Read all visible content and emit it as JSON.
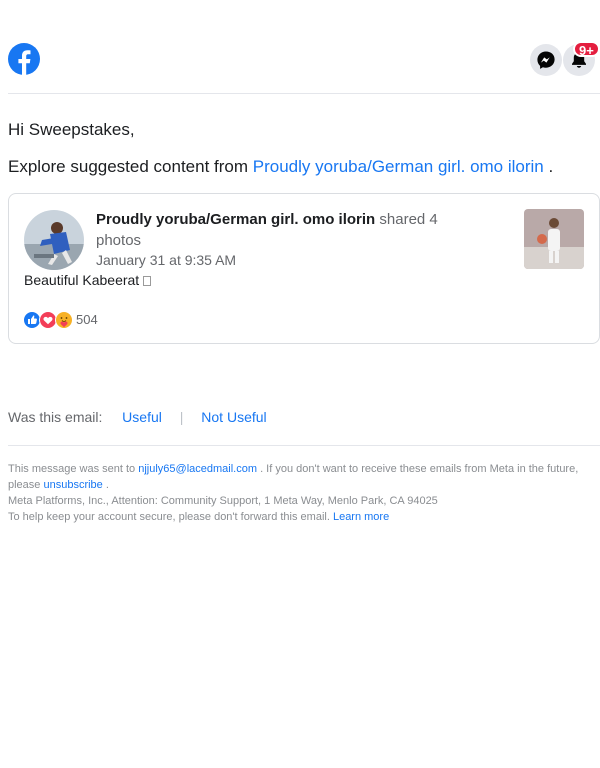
{
  "header": {
    "logo_icon": "facebook-logo-icon",
    "messenger_icon": "messenger-icon",
    "notifications_icon": "bell-icon",
    "notification_badge": "9+",
    "brand_color": "#1877f2",
    "badge_color": "#e41e3f"
  },
  "greeting": "Hi Sweepstakes,",
  "explore": {
    "prefix": "Explore suggested content from ",
    "page_link": "Proudly yoruba/German girl. omo ilorin",
    "suffix": " ."
  },
  "post": {
    "page_name": "Proudly yoruba/German girl. omo ilorin",
    "action": " shared 4 photos",
    "time": "January 31 at 9:35 AM",
    "caption": "Beautiful Kabeerat",
    "reaction_icons": [
      "like-icon",
      "love-icon",
      "care-icon"
    ],
    "reaction_count": "504"
  },
  "feedback": {
    "prompt": "Was this email:",
    "useful": "Useful",
    "separator": "|",
    "not_useful": "Not Useful"
  },
  "footer": {
    "sent_to_prefix": "This message was sent to ",
    "email": "njjuly65@lacedmail.com",
    "unsub_prefix": " . If you don't want to receive these emails from Meta in the future, please ",
    "unsubscribe": "unsubscribe",
    "unsub_suffix": " .",
    "address": "Meta Platforms, Inc., Attention: Community Support, 1 Meta Way, Menlo Park, CA 94025",
    "security_text": "To help keep your account secure, please don't forward this email. ",
    "learn_more": "Learn more"
  }
}
